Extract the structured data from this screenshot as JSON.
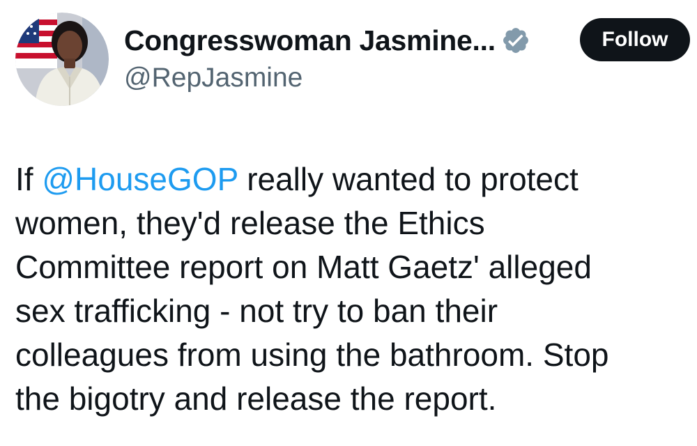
{
  "author": {
    "display_name": "Congresswoman Jasmine...",
    "handle": "@RepJasmine",
    "verified": true,
    "verified_badge_color": "#829aab",
    "avatar_icon": "profile-photo"
  },
  "follow_button": {
    "label": "Follow",
    "background": "#0f1419",
    "text_color": "#ffffff"
  },
  "tweet": {
    "mention": "@HouseGOP",
    "mention_color": "#1d9bf0",
    "line1_prefix": "If ",
    "line1_suffix": " really wanted to protect",
    "lines": [
      "women, they'd release the Ethics",
      "Committee report on Matt Gaetz' alleged",
      "sex trafficking - not try to ban their",
      "colleagues from using the bathroom. Stop",
      "the bigotry and release the report."
    ]
  }
}
